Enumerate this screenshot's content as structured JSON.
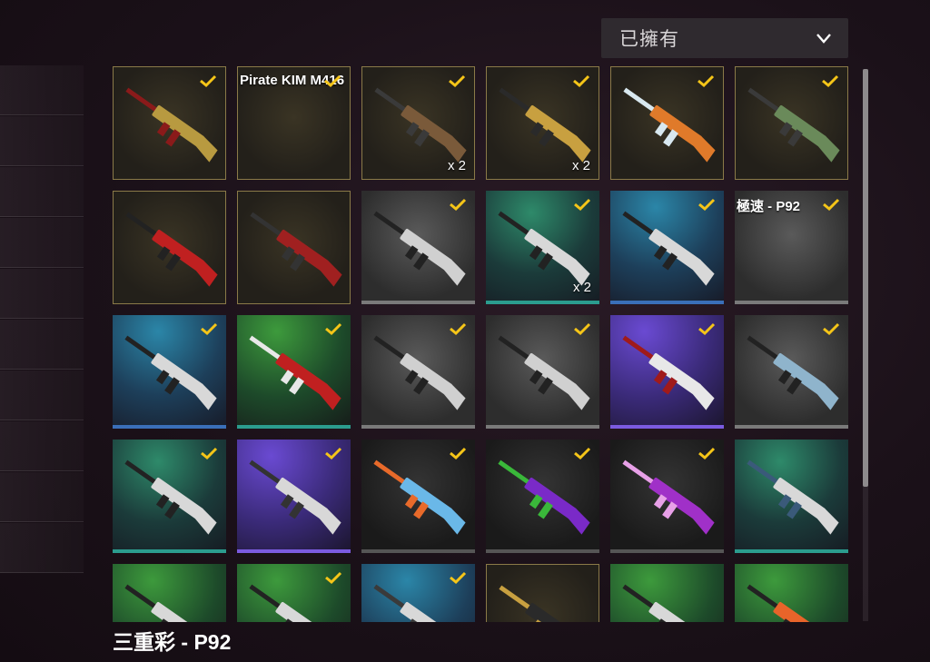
{
  "filter": {
    "selected": "已擁有"
  },
  "selected_item": {
    "name": "三重彩 - P92"
  },
  "colors": {
    "check": "#f5c518",
    "gold_border": "#8a7a48"
  },
  "items": [
    {
      "name": "",
      "owned": true,
      "count": "",
      "rarity": "gold",
      "gun_colors": [
        "#b89a40",
        "#8a1a1a"
      ]
    },
    {
      "name": "Pirate KIM M416",
      "owned": true,
      "count": "",
      "rarity": "gold",
      "gun_colors": []
    },
    {
      "name": "",
      "owned": true,
      "count": "x 2",
      "rarity": "gold",
      "gun_colors": [
        "#7a5a3a",
        "#3a3a3a"
      ]
    },
    {
      "name": "",
      "owned": true,
      "count": "x 2",
      "rarity": "gold",
      "gun_colors": [
        "#c8a040",
        "#2a2a2a"
      ]
    },
    {
      "name": "",
      "owned": true,
      "count": "",
      "rarity": "gold",
      "gun_colors": [
        "#e07a2a",
        "#d8e8f0"
      ]
    },
    {
      "name": "",
      "owned": true,
      "count": "",
      "rarity": "gold",
      "gun_colors": [
        "#6a8a5a",
        "#3a3a3a"
      ]
    },
    {
      "name": "",
      "owned": false,
      "count": "",
      "rarity": "gold",
      "gun_colors": [
        "#c02020",
        "#222"
      ]
    },
    {
      "name": "",
      "owned": false,
      "count": "",
      "rarity": "gold",
      "gun_colors": [
        "#a02020",
        "#333"
      ]
    },
    {
      "name": "",
      "owned": true,
      "count": "",
      "rarity": "gray",
      "gun_colors": [
        "#d0d0d0",
        "#222"
      ]
    },
    {
      "name": "",
      "owned": true,
      "count": "x 2",
      "rarity": "teal",
      "gun_colors": [
        "#d8d8d8",
        "#222"
      ]
    },
    {
      "name": "",
      "owned": true,
      "count": "",
      "rarity": "blue",
      "gun_colors": [
        "#d8d8d8",
        "#222"
      ]
    },
    {
      "name": "極速 - P92",
      "owned": true,
      "count": "",
      "rarity": "gray",
      "gun_colors": []
    },
    {
      "name": "",
      "owned": true,
      "count": "",
      "rarity": "blue",
      "gun_colors": [
        "#d8d8d8",
        "#222"
      ]
    },
    {
      "name": "",
      "owned": true,
      "count": "",
      "rarity": "green",
      "gun_colors": [
        "#c02020",
        "#e8e8e8"
      ]
    },
    {
      "name": "",
      "owned": true,
      "count": "",
      "rarity": "gray",
      "gun_colors": [
        "#d0d0d0",
        "#222"
      ]
    },
    {
      "name": "",
      "owned": true,
      "count": "",
      "rarity": "gray",
      "gun_colors": [
        "#d0d0d0",
        "#222"
      ]
    },
    {
      "name": "",
      "owned": true,
      "count": "",
      "rarity": "purple",
      "gun_colors": [
        "#e8e8e8",
        "#a01a1a"
      ]
    },
    {
      "name": "",
      "owned": true,
      "count": "",
      "rarity": "gray",
      "gun_colors": [
        "#8fb4cc",
        "#222"
      ]
    },
    {
      "name": "",
      "owned": true,
      "count": "",
      "rarity": "teal",
      "gun_colors": [
        "#d8d8d8",
        "#222"
      ]
    },
    {
      "name": "",
      "owned": true,
      "count": "",
      "rarity": "purple",
      "gun_colors": [
        "#d8d8d8",
        "#333"
      ]
    },
    {
      "name": "",
      "owned": true,
      "count": "",
      "rarity": "dark",
      "gun_colors": [
        "#6ab8e8",
        "#e86a2a"
      ]
    },
    {
      "name": "",
      "owned": true,
      "count": "",
      "rarity": "dark",
      "gun_colors": [
        "#7a2ac8",
        "#3ab83a"
      ]
    },
    {
      "name": "",
      "owned": true,
      "count": "",
      "rarity": "dark",
      "gun_colors": [
        "#a030c8",
        "#e8a0e8"
      ]
    },
    {
      "name": "",
      "owned": false,
      "count": "",
      "rarity": "teal",
      "gun_colors": [
        "#d8d8d8",
        "#3a5a7a"
      ]
    },
    {
      "name": "",
      "owned": false,
      "count": "",
      "rarity": "green",
      "gun_colors": [
        "#d8d8d8",
        "#222"
      ]
    },
    {
      "name": "",
      "owned": true,
      "count": "",
      "rarity": "green",
      "gun_colors": [
        "#d8d8d8",
        "#222"
      ]
    },
    {
      "name": "",
      "owned": true,
      "count": "",
      "rarity": "blue",
      "gun_colors": [
        "#d8d8d8",
        "#3a3a3a"
      ]
    },
    {
      "name": "",
      "owned": false,
      "count": "",
      "rarity": "gold",
      "gun_colors": [
        "#2a2a2a",
        "#c8a040"
      ]
    },
    {
      "name": "",
      "owned": false,
      "count": "",
      "rarity": "green",
      "gun_colors": [
        "#d8d8d8",
        "#222"
      ]
    },
    {
      "name": "",
      "owned": false,
      "count": "",
      "rarity": "green",
      "gun_colors": [
        "#e8642a",
        "#222"
      ]
    }
  ]
}
